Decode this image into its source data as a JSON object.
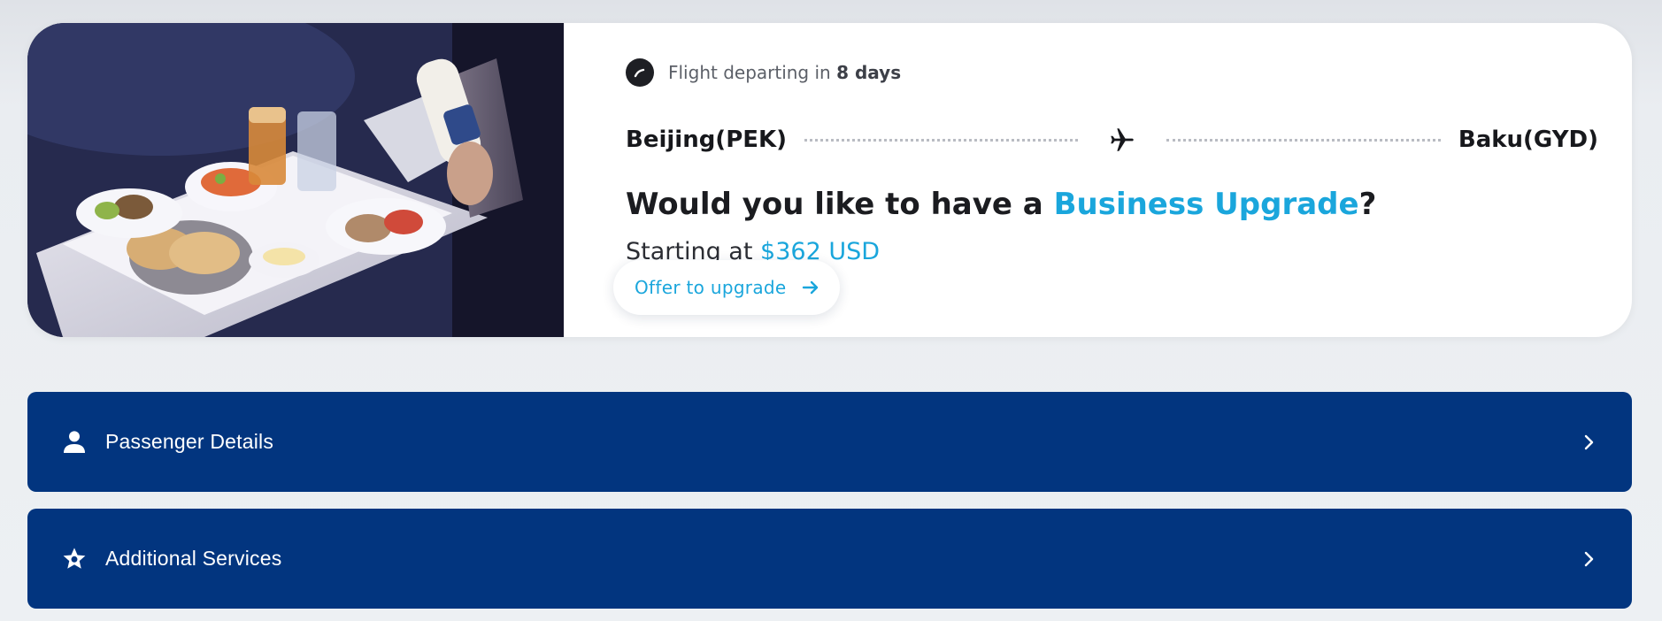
{
  "upgrade_card": {
    "departing": {
      "prefix": "Flight departing in",
      "days": "8 days",
      "icon": "clock-icon"
    },
    "route": {
      "origin": "Beijing(PEK)",
      "destination": "Baku(GYD)",
      "icon": "airplane-icon"
    },
    "question": {
      "prefix": "Would you like to have a",
      "highlight": "Business Upgrade",
      "suffix": "?"
    },
    "starting": {
      "label": "Starting at",
      "price": "$362 USD"
    },
    "offer_button": {
      "label": "Offer to upgrade",
      "icon": "arrow-right-icon"
    },
    "photo_alt": "In-flight meal tray",
    "colors": {
      "accent": "#1aa6dc",
      "text": "#1b1c20"
    }
  },
  "panels": [
    {
      "label": "Passenger Details",
      "icon": "person-icon"
    },
    {
      "label": "Additional Services",
      "icon": "star-icon"
    }
  ],
  "colors": {
    "panel_bg": "#02357f",
    "page_bg": "#edf0f3"
  }
}
